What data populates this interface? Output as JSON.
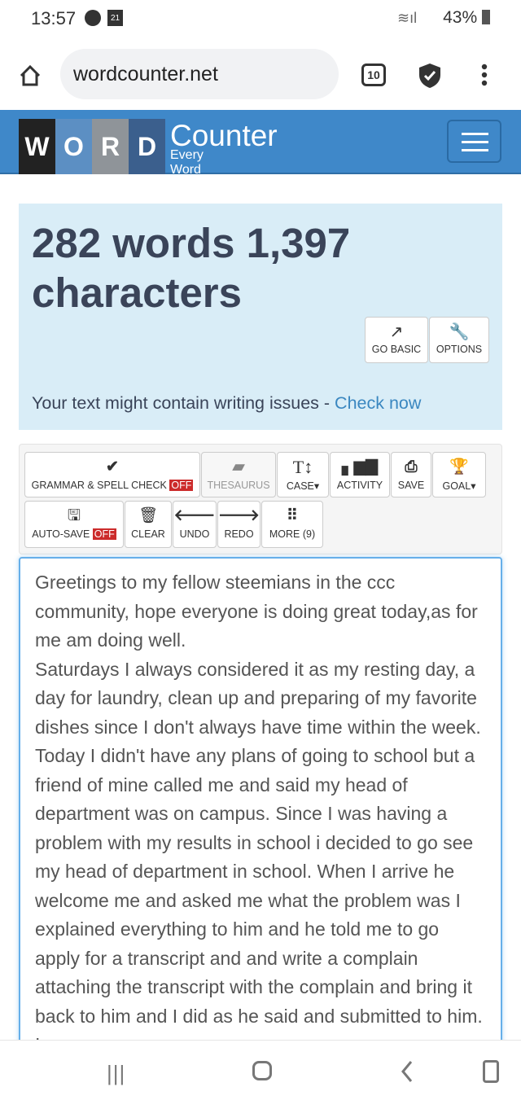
{
  "status_bar": {
    "time": "13:57",
    "calendar_day": "21",
    "battery": "43%"
  },
  "browser": {
    "url": "wordcounter.net",
    "tab_count": "10"
  },
  "site": {
    "logo_letters": [
      "W",
      "O",
      "R",
      "D"
    ],
    "logo_word": "Counter",
    "tagline": "Every Word Counts"
  },
  "stats": {
    "summary": "282 words 1,397 characters",
    "go_basic": "GO BASIC",
    "options": "OPTIONS",
    "issues_text": "Your text might contain writing issues - ",
    "issues_link": "Check now"
  },
  "toolbar": {
    "grammar": "GRAMMAR & SPELL CHECK",
    "grammar_state": "OFF",
    "thesaurus": "THESAURUS",
    "case": "CASE",
    "activity": "ACTIVITY",
    "save": "SAVE",
    "goal": "GOAL",
    "autosave": "AUTO-SAVE",
    "autosave_state": "OFF",
    "clear": "CLEAR",
    "undo": "UNDO",
    "redo": "REDO",
    "more": "MORE (9)"
  },
  "editor": {
    "text": "Greetings to my fellow steemians in the ccc community, hope everyone is doing great today,as for me am doing well.\nSaturdays I always considered it as my resting day, a day for laundry, clean up and preparing of my favorite dishes since I don't always have time within the week. Today I didn't have any plans of going to school but a friend of mine called me and said my head of department was on campus. Since I was having a problem with my results in school i decided to go see my head of department in school. When I arrive he welcome me and asked me what the problem was I explained everything to him and he told me to go apply for a transcript and and write a complain attaching the transcript with the complain and bring it back to him and I did as he said and submitted to him. I"
  },
  "colors": {
    "header": "#3f88c9",
    "stats_bg": "#d9edf7",
    "off_badge": "#cc2b2b",
    "link": "#3a87c0"
  }
}
